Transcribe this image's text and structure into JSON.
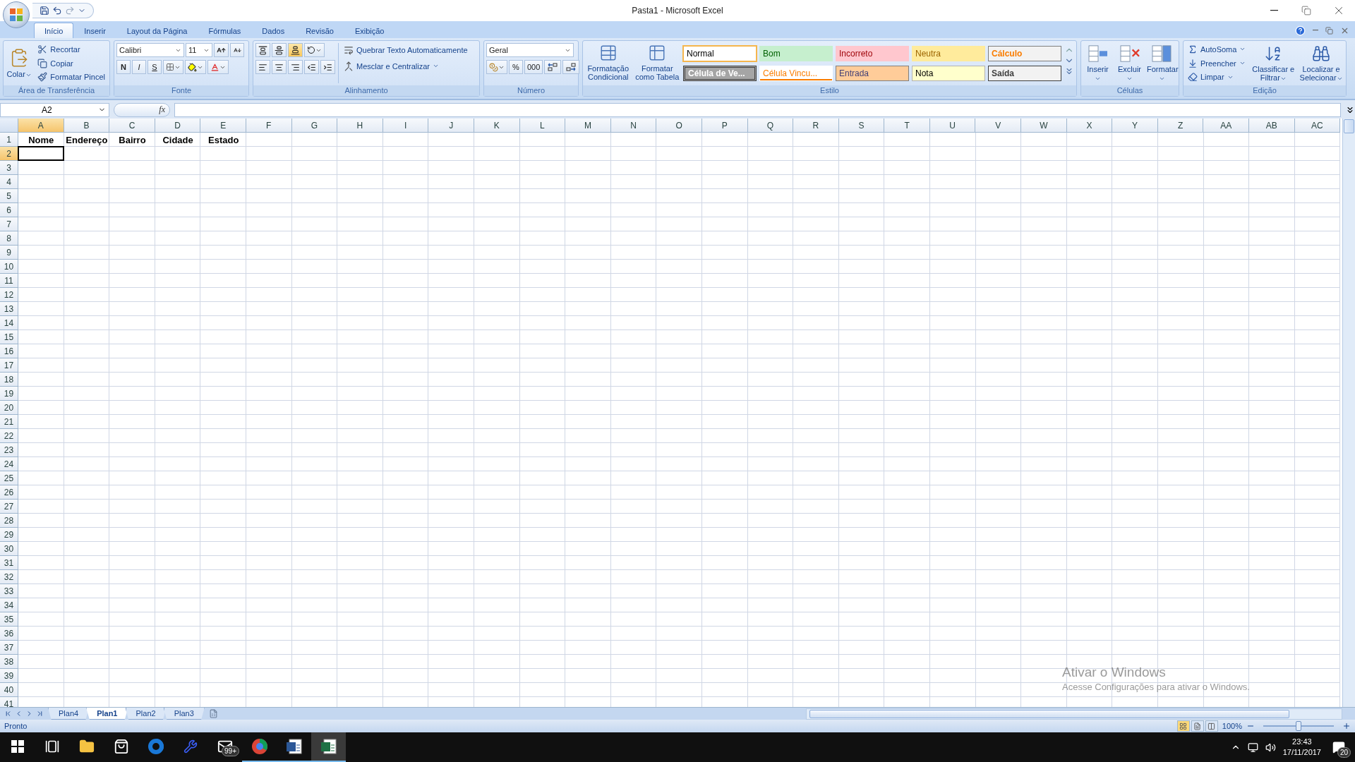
{
  "window": {
    "title": "Pasta1 - Microsoft Excel"
  },
  "ribbon_tabs": [
    {
      "label": "Início",
      "selected": true
    },
    {
      "label": "Inserir",
      "selected": false
    },
    {
      "label": "Layout da Página",
      "selected": false
    },
    {
      "label": "Fórmulas",
      "selected": false
    },
    {
      "label": "Dados",
      "selected": false
    },
    {
      "label": "Revisão",
      "selected": false
    },
    {
      "label": "Exibição",
      "selected": false
    }
  ],
  "clipboard": {
    "label": "Área de Transferência",
    "paste": "Colar",
    "commands": [
      "Recortar",
      "Copiar",
      "Formatar Pincel"
    ]
  },
  "font": {
    "label": "Fonte",
    "font_name": "Calibri",
    "font_size": "11",
    "bold": "N",
    "italic": "I",
    "underline": "S"
  },
  "alignment": {
    "label": "Alinhamento",
    "vertical": [
      {
        "selected": false
      },
      {
        "selected": false
      },
      {
        "selected": true
      }
    ],
    "wrap_text": "Quebrar Texto Automaticamente",
    "merge": "Mesclar e Centralizar"
  },
  "number": {
    "label": "Número",
    "format": "Geral",
    "percent": "%",
    "thousands": "000"
  },
  "styles": {
    "label": "Estilo",
    "commands": [
      "Formatação Condicional",
      "Formatar como Tabela"
    ],
    "cell_styles": [
      {
        "label": "Normal",
        "kind": "normal",
        "selected": true
      },
      {
        "label": "Bom",
        "kind": "good",
        "selected": false
      },
      {
        "label": "Incorreto",
        "kind": "bad",
        "selected": false
      },
      {
        "label": "Neutra",
        "kind": "neutral",
        "selected": false
      },
      {
        "label": "Cálculo",
        "kind": "calculation",
        "selected": false
      },
      {
        "label": "Célula de Ve...",
        "kind": "check",
        "selected": false
      },
      {
        "label": "Célula Vincu...",
        "kind": "linked",
        "selected": false
      },
      {
        "label": "Entrada",
        "kind": "input",
        "selected": false
      },
      {
        "label": "Nota",
        "kind": "note",
        "selected": false
      },
      {
        "label": "Saída",
        "kind": "output",
        "selected": false
      }
    ]
  },
  "cells": {
    "label": "Células",
    "commands": [
      "Inserir",
      "Excluir",
      "Formatar"
    ]
  },
  "editing": {
    "label": "Edição",
    "small_commands": [
      "AutoSoma",
      "Preencher",
      "Limpar"
    ],
    "big_commands": [
      "Classificar e Filtrar",
      "Localizar e Selecionar"
    ]
  },
  "formula_bar": {
    "name_box": "A2",
    "function_label": "fx"
  },
  "columns": [
    {
      "label": "A",
      "selected": true
    },
    {
      "label": "B",
      "selected": false
    },
    {
      "label": "C",
      "selected": false
    },
    {
      "label": "D",
      "selected": false
    },
    {
      "label": "E",
      "selected": false
    },
    {
      "label": "F",
      "selected": false
    },
    {
      "label": "G",
      "selected": false
    },
    {
      "label": "H",
      "selected": false
    },
    {
      "label": "I",
      "selected": false
    },
    {
      "label": "J",
      "selected": false
    },
    {
      "label": "K",
      "selected": false
    },
    {
      "label": "L",
      "selected": false
    },
    {
      "label": "M",
      "selected": false
    },
    {
      "label": "N",
      "selected": false
    },
    {
      "label": "O",
      "selected": false
    },
    {
      "label": "P",
      "selected": false
    },
    {
      "label": "Q",
      "selected": false
    },
    {
      "label": "R",
      "selected": false
    },
    {
      "label": "S",
      "selected": false
    },
    {
      "label": "T",
      "selected": false
    },
    {
      "label": "U",
      "selected": false
    },
    {
      "label": "V",
      "selected": false
    },
    {
      "label": "W",
      "selected": false
    },
    {
      "label": "X",
      "selected": false
    },
    {
      "label": "Y",
      "selected": false
    },
    {
      "label": "Z",
      "selected": false
    },
    {
      "label": "AA",
      "selected": false
    },
    {
      "label": "AB",
      "selected": false
    },
    {
      "label": "AC",
      "selected": false
    }
  ],
  "rows": [
    {
      "label": "1",
      "selected": false,
      "cells": [
        "Nome",
        "Endereço",
        "Bairro",
        "Cidade",
        "Estado"
      ]
    },
    {
      "label": "2",
      "selected": true
    },
    {
      "label": "3",
      "selected": false
    },
    {
      "label": "4",
      "selected": false
    },
    {
      "label": "5",
      "selected": false
    },
    {
      "label": "6",
      "selected": false
    },
    {
      "label": "7",
      "selected": false
    },
    {
      "label": "8",
      "selected": false
    },
    {
      "label": "9",
      "selected": false
    },
    {
      "label": "10",
      "selected": false
    },
    {
      "label": "11",
      "selected": false
    },
    {
      "label": "12",
      "selected": false
    },
    {
      "label": "13",
      "selected": false
    },
    {
      "label": "14",
      "selected": false
    },
    {
      "label": "15",
      "selected": false
    },
    {
      "label": "16",
      "selected": false
    },
    {
      "label": "17",
      "selected": false
    },
    {
      "label": "18",
      "selected": false
    },
    {
      "label": "19",
      "selected": false
    },
    {
      "label": "20",
      "selected": false
    },
    {
      "label": "21",
      "selected": false
    },
    {
      "label": "22",
      "selected": false
    },
    {
      "label": "23",
      "selected": false
    },
    {
      "label": "24",
      "selected": false
    },
    {
      "label": "25",
      "selected": false
    },
    {
      "label": "26",
      "selected": false
    },
    {
      "label": "27",
      "selected": false
    },
    {
      "label": "28",
      "selected": false
    },
    {
      "label": "29",
      "selected": false
    },
    {
      "label": "30",
      "selected": false
    },
    {
      "label": "31",
      "selected": false
    },
    {
      "label": "32",
      "selected": false
    },
    {
      "label": "33",
      "selected": false
    },
    {
      "label": "34",
      "selected": false
    },
    {
      "label": "35",
      "selected": false
    },
    {
      "label": "36",
      "selected": false
    },
    {
      "label": "37",
      "selected": false
    },
    {
      "label": "38",
      "selected": false
    },
    {
      "label": "39",
      "selected": false
    },
    {
      "label": "40",
      "selected": false
    },
    {
      "label": "41",
      "selected": false
    }
  ],
  "activation_notice": {
    "title": "Ativar o Windows",
    "text": "Acesse Configurações para ativar o Windows."
  },
  "sheet_tabs": [
    {
      "label": "Plan4",
      "selected": false
    },
    {
      "label": "Plan1",
      "selected": true
    },
    {
      "label": "Plan2",
      "selected": false
    },
    {
      "label": "Plan3",
      "selected": false
    }
  ],
  "status_bar": {
    "status": "Pronto",
    "views": [
      {
        "selected": true
      },
      {
        "selected": false
      },
      {
        "selected": false
      }
    ],
    "zoom": "100%",
    "zoom_slider": {
      "level": 0.5
    }
  },
  "taskbar": {
    "apps": [
      {
        "kind": "start",
        "open": false,
        "active": false
      },
      {
        "kind": "taskview",
        "open": false,
        "active": false
      },
      {
        "kind": "explorer",
        "open": false,
        "active": false
      },
      {
        "kind": "store",
        "open": false,
        "active": false
      },
      {
        "kind": "edge",
        "open": false,
        "active": false
      },
      {
        "kind": "tool",
        "open": false,
        "active": false
      },
      {
        "kind": "mail",
        "open": false,
        "active": false,
        "badge": "99+"
      },
      {
        "kind": "chrome",
        "open": true,
        "active": false
      },
      {
        "kind": "word",
        "open": true,
        "active": false
      },
      {
        "kind": "excel",
        "open": true,
        "active": true
      }
    ],
    "time": "23:43",
    "date": "17/11/2017",
    "notifications": "20"
  }
}
